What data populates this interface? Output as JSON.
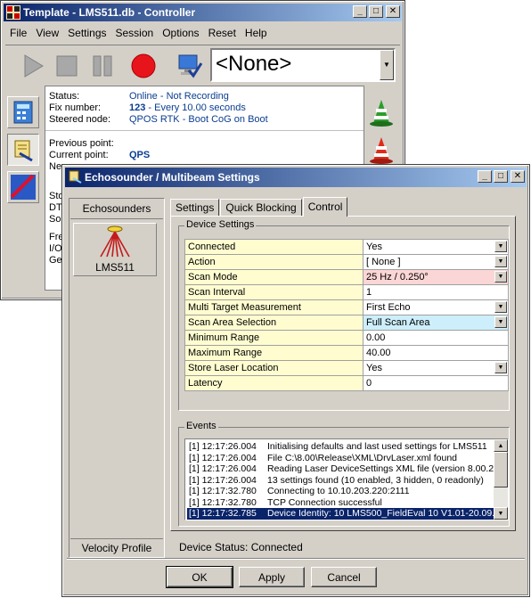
{
  "controller": {
    "title": "Template - LMS511.db - Controller",
    "menu": [
      "File",
      "View",
      "Settings",
      "Session",
      "Options",
      "Reset",
      "Help"
    ],
    "combo_value": "<None>",
    "status": {
      "status_label": "Status:",
      "status_value": "Online - Not Recording",
      "fix_label": "Fix number:",
      "fix_number": "123",
      "fix_suffix": " - Every 10.00 seconds",
      "steered_label": "Steered node:",
      "steered_value": "QPOS RTK - Boot CoG on Boot",
      "prev_label": "Previous point:",
      "current_label": "Current point:",
      "current_value": "QPS",
      "next_label": "Ne",
      "row_sto": "Sto",
      "row_dt": "DT",
      "row_so": "So",
      "row_fre": "Fre",
      "row_io": "I/O",
      "row_ge": "Ge"
    }
  },
  "dialog": {
    "title": "Echosounder / Multibeam Settings",
    "sidebar": {
      "header": "Echosounders",
      "device": "LMS511",
      "footer": "Velocity Profile"
    },
    "tabs": [
      "Settings",
      "Quick Blocking",
      "Control"
    ],
    "device_settings": {
      "legend": "Device Settings",
      "rows": [
        {
          "name": "Connected",
          "value": "Yes",
          "drop": true,
          "color": ""
        },
        {
          "name": "Action",
          "value": "[ None ]",
          "drop": true,
          "color": ""
        },
        {
          "name": "Scan Mode",
          "value": "25 Hz / 0.250°",
          "drop": true,
          "color": "pink"
        },
        {
          "name": "Scan Interval",
          "value": "1",
          "drop": false,
          "color": ""
        },
        {
          "name": "Multi Target Measurement",
          "value": "First Echo",
          "drop": true,
          "color": ""
        },
        {
          "name": "Scan Area Selection",
          "value": "Full Scan Area",
          "drop": true,
          "color": "cyan"
        },
        {
          "name": "Minimum Range",
          "value": "0.00",
          "drop": false,
          "color": ""
        },
        {
          "name": "Maximum Range",
          "value": "40.00",
          "drop": false,
          "color": ""
        },
        {
          "name": "Store Laser Location",
          "value": "Yes",
          "drop": true,
          "color": ""
        },
        {
          "name": "Latency",
          "value": "0",
          "drop": false,
          "color": ""
        }
      ]
    },
    "events": {
      "legend": "Events",
      "items": [
        {
          "time": "[1] 12:17:26.004",
          "text": "Initialising defaults and last used settings for LMS511",
          "selected": false
        },
        {
          "time": "[1] 12:17:26.004",
          "text": "File C:\\8.00\\Release\\XML\\DrvLaser.xml found",
          "selected": false
        },
        {
          "time": "[1] 12:17:26.004",
          "text": "Reading Laser DeviceSettings XML file (version 8.00.2",
          "selected": false
        },
        {
          "time": "[1] 12:17:26.004",
          "text": "13 settings found (10 enabled, 3 hidden, 0 readonly)",
          "selected": false
        },
        {
          "time": "[1] 12:17:32.780",
          "text": "Connecting to 10.10.203.220:2111",
          "selected": false
        },
        {
          "time": "[1] 12:17:32.780",
          "text": "TCP Connection successful",
          "selected": false
        },
        {
          "time": "[1] 12:17:32.785",
          "text": "Device Identity: 10 LMS500_FieldEval 10 V1.01-20.09.",
          "selected": true
        }
      ]
    },
    "device_status": "Device Status: Connected",
    "buttons": {
      "ok": "OK",
      "apply": "Apply",
      "cancel": "Cancel"
    }
  }
}
